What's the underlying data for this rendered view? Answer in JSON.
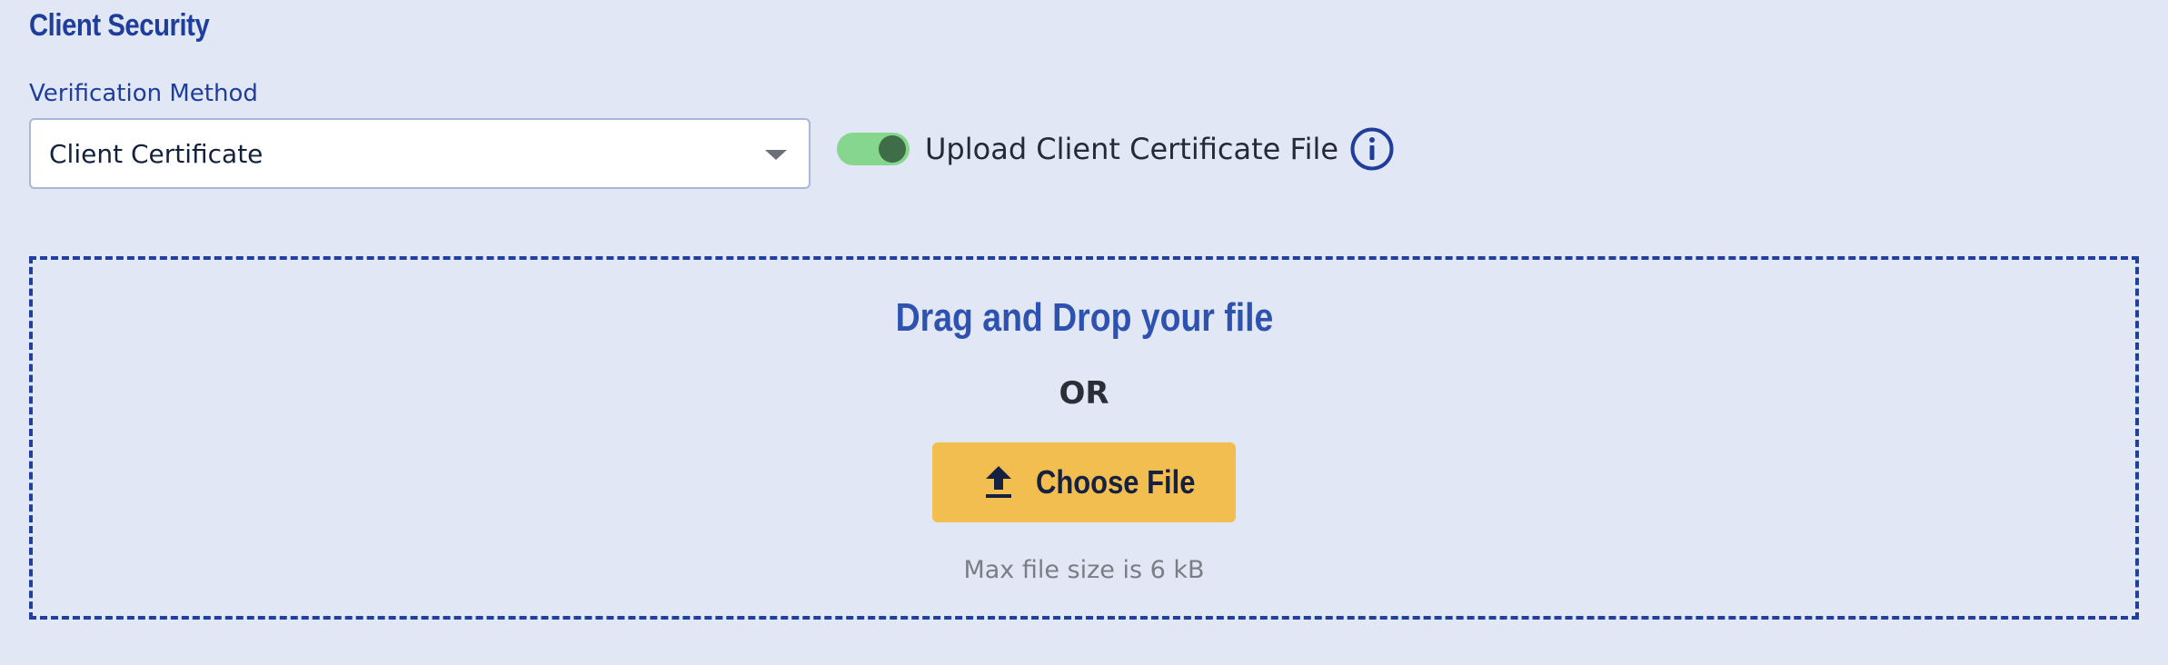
{
  "section": {
    "title": "Client Security"
  },
  "verification": {
    "label": "Verification Method",
    "selected": "Client Certificate"
  },
  "upload_toggle": {
    "label": "Upload Client Certificate File",
    "on": true
  },
  "dropzone": {
    "title": "Drag and Drop your file",
    "or_text": "OR",
    "button_label": "Choose File",
    "hint": "Max file size is 6 kB"
  },
  "icons": {
    "info": "info-icon",
    "upload": "upload-icon",
    "caret": "caret-down-icon"
  },
  "colors": {
    "background": "#e1e7f4",
    "accent": "#1f3e9c",
    "toggle_on": "#86d68e",
    "button": "#f2be50"
  }
}
